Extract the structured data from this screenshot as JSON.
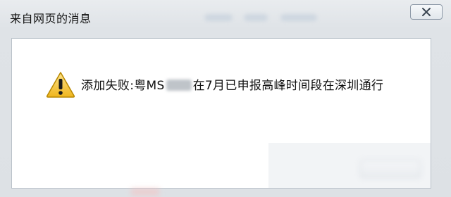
{
  "window": {
    "title": "来自网页的消息"
  },
  "message": {
    "prefix": "添加失败:粤MS",
    "suffix": "在7月已申报高峰时间段在深圳通行"
  },
  "icons": {
    "warning": "warning-icon",
    "close": "close-icon"
  },
  "colors": {
    "warning_yellow": "#f2c230",
    "warning_border": "#b88700",
    "frame_bg": "#dfe3e7",
    "panel_bg": "#ffffff"
  }
}
